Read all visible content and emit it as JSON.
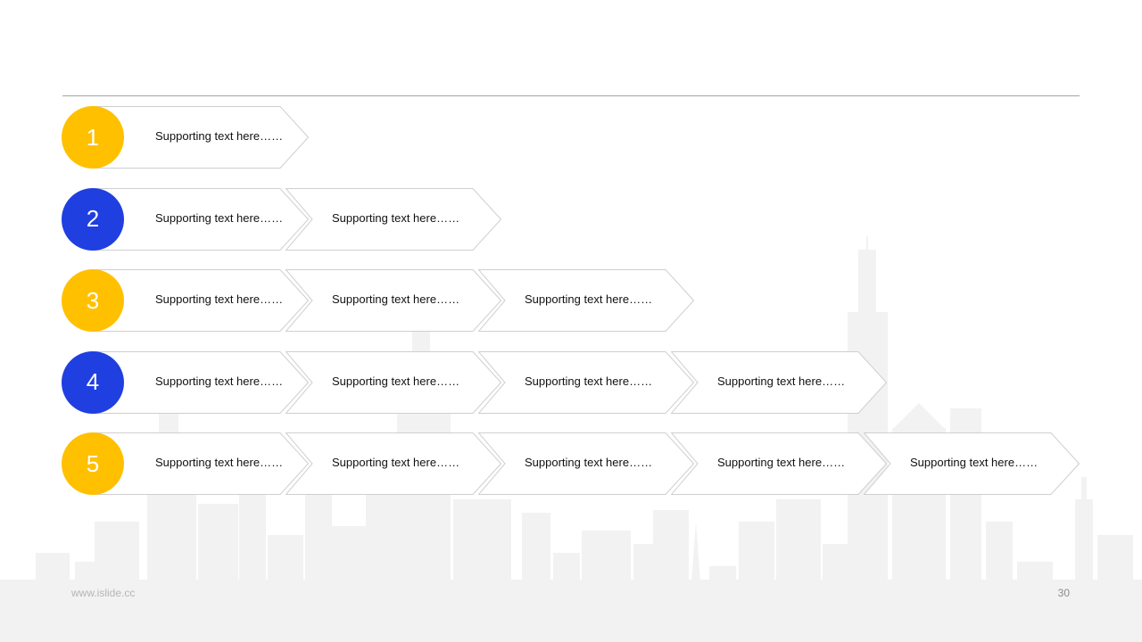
{
  "colors": {
    "yellow": "#FFC000",
    "blue": "#1F3FE0",
    "chevron_border": "#cfcfcf"
  },
  "rows": [
    {
      "number": "1",
      "color": "yellow",
      "items": [
        "Supporting  text here……"
      ]
    },
    {
      "number": "2",
      "color": "blue",
      "items": [
        "Supporting  text here……",
        "Supporting  text here……"
      ]
    },
    {
      "number": "3",
      "color": "yellow",
      "items": [
        "Supporting  text here……",
        "Supporting  text here……",
        "Supporting  text here……"
      ]
    },
    {
      "number": "4",
      "color": "blue",
      "items": [
        "Supporting  text here……",
        "Supporting  text here……",
        "Supporting  text here……",
        "Supporting  text here……"
      ]
    },
    {
      "number": "5",
      "color": "yellow",
      "items": [
        "Supporting  text here……",
        "Supporting  text here……",
        "Supporting  text here……",
        "Supporting  text here……",
        "Supporting  text here……"
      ]
    }
  ],
  "footer": {
    "url": "www.islide.cc",
    "page_number": "30"
  }
}
